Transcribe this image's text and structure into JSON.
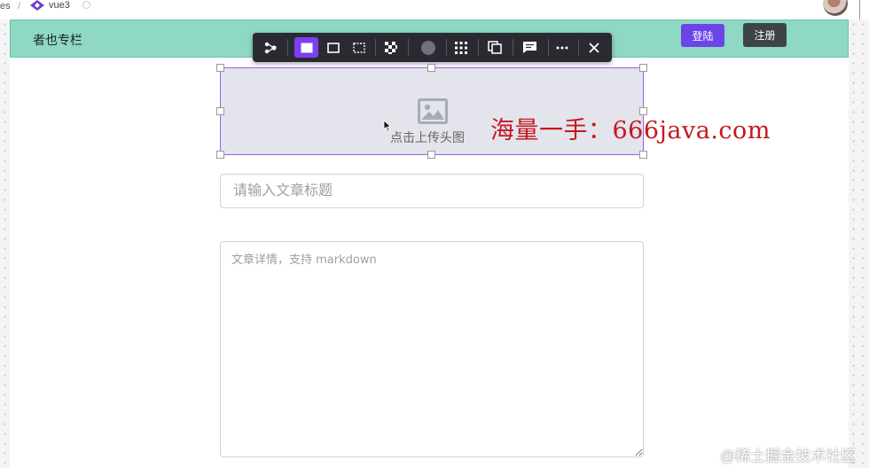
{
  "breadcrumb": {
    "fragment": "es",
    "separator": "/",
    "project": "vue3"
  },
  "header": {
    "brand": "者也专栏",
    "login_label": "登陆",
    "register_label": "注册"
  },
  "toolbar": {
    "items": [
      "move-icon",
      "fill-solid-icon",
      "border-icon",
      "dashed-border-icon",
      "pattern-icon",
      "circle-icon",
      "grid-icon",
      "copy-icon",
      "comment-icon",
      "more-icon",
      "close-icon"
    ]
  },
  "upload": {
    "text": "点击上传头图",
    "icon": "image-icon"
  },
  "form": {
    "title_placeholder": "请输入文章标题",
    "content_placeholder": "文章详情，支持 markdown"
  },
  "watermarks": {
    "overlay": "海量一手：666java.com",
    "corner": "@稀土掘金技术社区"
  },
  "colors": {
    "nav_bg": "#8fd8c4",
    "login_bg": "#6c44e8",
    "register_bg": "#3e4446",
    "toolbar_bg": "#2a2b32",
    "active_tool": "#7d3ff0",
    "upload_border": "#9b5de5",
    "watermark_red": "#c4191e"
  }
}
